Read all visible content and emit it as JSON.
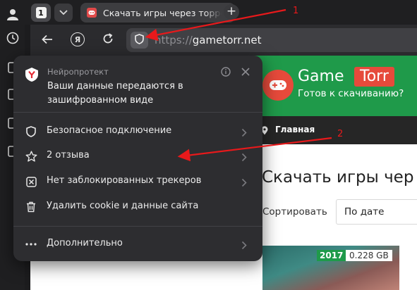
{
  "browser": {
    "tab_count": "1",
    "active_tab": {
      "title": "Скачать игры через торрент"
    },
    "address_bar": {
      "scheme": "https://",
      "host": "gametorr.net"
    }
  },
  "website": {
    "logo_game": "Game",
    "logo_torr": "Torr",
    "tagline": "Готов к скачиванию?",
    "breadcrumb": "Главная",
    "title": "Скачать игры чер",
    "sort_label": "Сортировать",
    "sort_value": "По дате",
    "card": {
      "year": "2017",
      "size": "0.228 GB"
    },
    "colors": {
      "header": "#1f9a4a",
      "accent": "#e64a3b"
    }
  },
  "popup": {
    "app_name": "Нейропротект",
    "message": "Ваши данные передаются в зашифрованном виде",
    "items": [
      {
        "icon": "shield-icon",
        "label": "Безопасное подключение"
      },
      {
        "icon": "star-icon",
        "label": "2 отзыва"
      },
      {
        "icon": "tracker-block-icon",
        "label": "Нет заблокированных трекеров"
      },
      {
        "icon": "trash-icon",
        "label": "Удалить cookie и данные сайта"
      },
      {
        "icon": "more-dots-icon",
        "label": "Дополнительно"
      }
    ]
  },
  "annotations": {
    "arrow1_label": "1",
    "arrow2_label": "2",
    "color": "#e8191b"
  }
}
